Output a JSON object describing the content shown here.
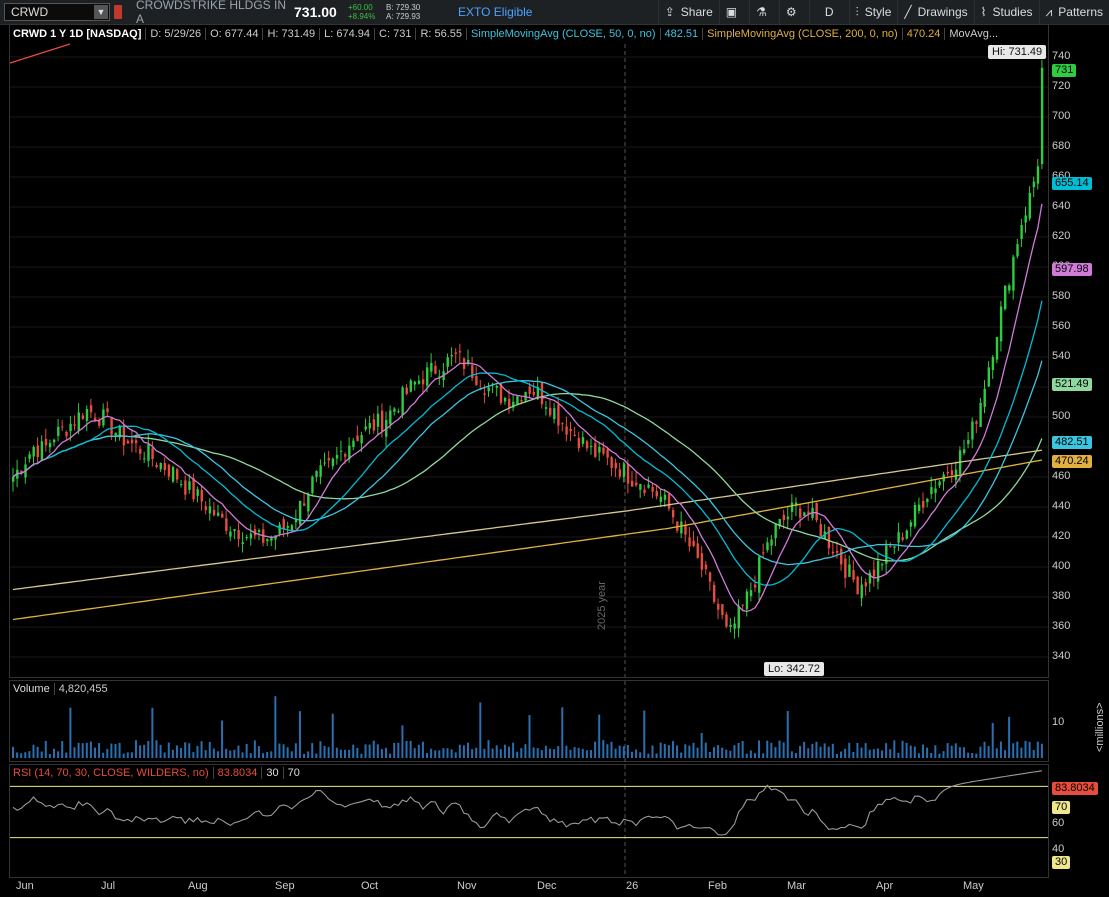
{
  "toolbar": {
    "symbol": "CRWD",
    "company": "CROWDSTRIKE HLDGS IN A",
    "price": "731.00",
    "change": "+60.00",
    "change_pct": "+8.94%",
    "bid": "B: 729.30",
    "ask": "A: 729.93",
    "exto": "EXTO Eligible",
    "buttons": [
      {
        "label": "Share",
        "icon": "share-icon"
      },
      {
        "label": "",
        "icon": "screenshot-icon"
      },
      {
        "label": "",
        "icon": "flask-icon"
      },
      {
        "label": "",
        "icon": "gear-icon"
      },
      {
        "label": "D",
        "icon": ""
      },
      {
        "label": "Style",
        "icon": "candles-icon"
      },
      {
        "label": "Drawings",
        "icon": "pencil-icon"
      },
      {
        "label": "Studies",
        "icon": "studies-icon"
      },
      {
        "label": "Patterns",
        "icon": "patterns-icon"
      }
    ]
  },
  "info": {
    "ticker": "CRWD 1 Y 1D [NASDAQ]",
    "date": "D: 5/29/26",
    "open": "O: 677.44",
    "high": "H: 731.49",
    "low": "L: 674.94",
    "close": "C: 731",
    "range": "R: 56.55",
    "sma50_label": "SimpleMovingAvg (CLOSE, 50, 0, no)",
    "sma50_value": "482.51",
    "sma200_label": "SimpleMovingAvg (CLOSE, 200, 0, no)",
    "sma200_value": "470.24",
    "movavg": "MovAvg..."
  },
  "price_axis": [
    "740",
    "720",
    "700",
    "680",
    "660",
    "640",
    "620",
    "600",
    "580",
    "560",
    "540",
    "520",
    "500",
    "480",
    "460",
    "440",
    "420",
    "400",
    "380",
    "360",
    "340"
  ],
  "badges": [
    {
      "text": "731",
      "bg": "#2ecc40",
      "fg": "#000",
      "value": 731
    },
    {
      "text": "655.14",
      "bg": "#00bcd4",
      "fg": "#000",
      "value": 655.14
    },
    {
      "text": "597.98",
      "bg": "#d07bd8",
      "fg": "#000",
      "value": 597.98
    },
    {
      "text": "521.49",
      "bg": "#8fd8a0",
      "fg": "#000",
      "value": 521.49
    },
    {
      "text": "482.51",
      "bg": "#3cc5e0",
      "fg": "#000",
      "value": 482.51
    },
    {
      "text": "470.24",
      "bg": "#e0b040",
      "fg": "#000",
      "value": 470.24
    }
  ],
  "hi_label": "Hi: 731.49",
  "lo_label": "Lo: 342.72",
  "year_label": "2025 year",
  "volume": {
    "label": "Volume",
    "value": "4,820,455",
    "axis": [
      "10"
    ],
    "unit": "<millions>"
  },
  "rsi": {
    "label": "RSI (14, 70, 30, CLOSE, WILDERS, no)",
    "value": "83.8034",
    "ob": "30",
    "os": "70",
    "axis": [
      "60",
      "40"
    ],
    "badges": [
      {
        "text": "83.8034",
        "bg": "#e74c3c",
        "fg": "#000"
      },
      {
        "text": "70",
        "bg": "#f0e68c",
        "fg": "#000"
      },
      {
        "text": "30",
        "bg": "#f0e68c",
        "fg": "#000"
      }
    ]
  },
  "x_axis": [
    "Jun",
    "Jul",
    "Aug",
    "Sep",
    "Oct",
    "Nov",
    "Dec",
    "26",
    "Feb",
    "Mar",
    "Apr",
    "May"
  ],
  "chart_data": {
    "type": "candlestick",
    "ylim": [
      330,
      745
    ],
    "close_path": [
      [
        0,
        460
      ],
      [
        8,
        470
      ],
      [
        16,
        480
      ],
      [
        24,
        478
      ],
      [
        32,
        488
      ],
      [
        40,
        492
      ],
      [
        48,
        498
      ],
      [
        56,
        505
      ],
      [
        64,
        502
      ],
      [
        72,
        498
      ],
      [
        80,
        490
      ],
      [
        88,
        484
      ],
      [
        96,
        480
      ],
      [
        104,
        476
      ],
      [
        112,
        470
      ],
      [
        120,
        466
      ],
      [
        128,
        460
      ],
      [
        136,
        452
      ],
      [
        144,
        446
      ],
      [
        152,
        440
      ],
      [
        160,
        432
      ],
      [
        168,
        428
      ],
      [
        176,
        424
      ],
      [
        184,
        420
      ],
      [
        192,
        418
      ],
      [
        200,
        420
      ],
      [
        208,
        424
      ],
      [
        216,
        430
      ],
      [
        224,
        442
      ],
      [
        232,
        456
      ],
      [
        240,
        462
      ],
      [
        248,
        468
      ],
      [
        256,
        478
      ],
      [
        264,
        486
      ],
      [
        272,
        490
      ],
      [
        280,
        494
      ],
      [
        288,
        498
      ],
      [
        296,
        506
      ],
      [
        304,
        514
      ],
      [
        312,
        522
      ],
      [
        320,
        528
      ],
      [
        328,
        532
      ],
      [
        336,
        536
      ],
      [
        344,
        540
      ],
      [
        352,
        535
      ],
      [
        360,
        528
      ],
      [
        368,
        520
      ],
      [
        376,
        516
      ],
      [
        384,
        512
      ],
      [
        392,
        514
      ],
      [
        400,
        520
      ],
      [
        408,
        516
      ],
      [
        416,
        510
      ],
      [
        424,
        500
      ],
      [
        432,
        492
      ],
      [
        440,
        486
      ],
      [
        448,
        478
      ],
      [
        456,
        474
      ],
      [
        464,
        470
      ],
      [
        472,
        466
      ],
      [
        480,
        460
      ],
      [
        488,
        458
      ],
      [
        496,
        452
      ],
      [
        504,
        446
      ],
      [
        512,
        436
      ],
      [
        520,
        424
      ],
      [
        528,
        410
      ],
      [
        536,
        398
      ],
      [
        544,
        380
      ],
      [
        552,
        364
      ],
      [
        556,
        352
      ],
      [
        560,
        360
      ],
      [
        568,
        374
      ],
      [
        576,
        390
      ],
      [
        584,
        410
      ],
      [
        592,
        424
      ],
      [
        600,
        432
      ],
      [
        608,
        440
      ],
      [
        616,
        438
      ],
      [
        624,
        430
      ],
      [
        632,
        420
      ],
      [
        640,
        410
      ],
      [
        648,
        398
      ],
      [
        656,
        388
      ],
      [
        664,
        392
      ],
      [
        672,
        400
      ],
      [
        680,
        410
      ],
      [
        688,
        418
      ],
      [
        696,
        428
      ],
      [
        704,
        440
      ],
      [
        712,
        452
      ],
      [
        720,
        458
      ],
      [
        728,
        466
      ],
      [
        736,
        474
      ],
      [
        744,
        486
      ],
      [
        752,
        510
      ],
      [
        760,
        540
      ],
      [
        768,
        570
      ],
      [
        776,
        600
      ],
      [
        784,
        630
      ],
      [
        792,
        650
      ],
      [
        798,
        676
      ],
      [
        800,
        731
      ]
    ]
  }
}
